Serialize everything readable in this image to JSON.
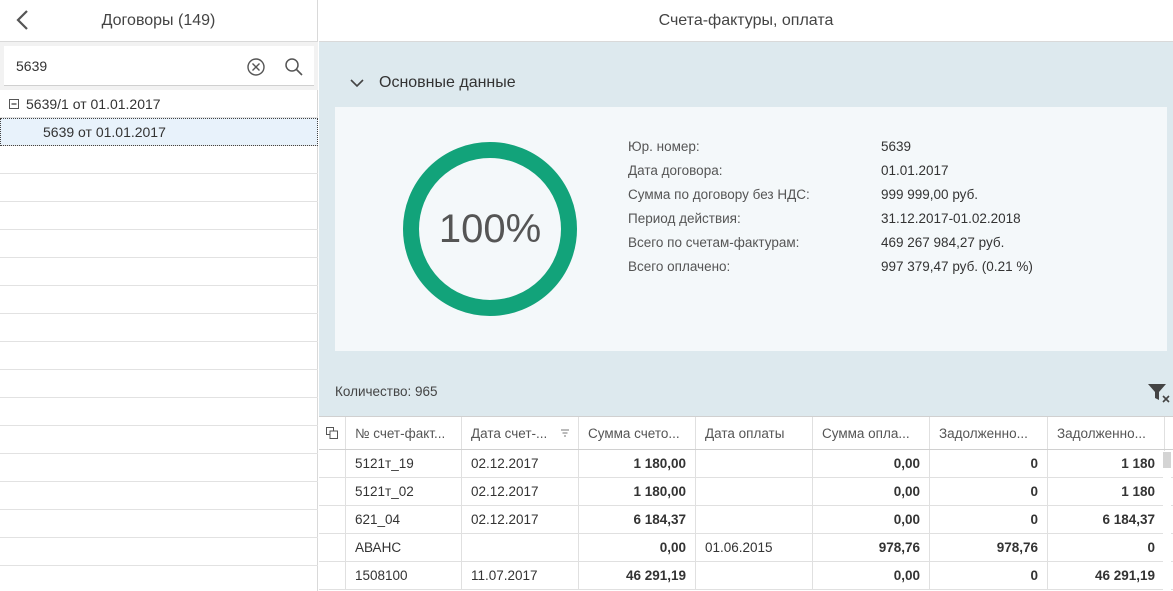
{
  "left": {
    "title": "Договоры (149)",
    "search_value": "5639",
    "tree": [
      {
        "label": "5639/1 от 01.01.2017"
      },
      {
        "label": "5639 от 01.01.2017"
      }
    ]
  },
  "right": {
    "title": "Счета-фактуры, оплата",
    "section_title": "Основные данные",
    "progress_percent": 100,
    "progress_text": "100%",
    "info": [
      {
        "label": "Юр. номер:",
        "value": "5639"
      },
      {
        "label": "Дата договора:",
        "value": "01.01.2017"
      },
      {
        "label": "Сумма по договору без НДС:",
        "value": "999 999,00 руб."
      },
      {
        "label": "Период действия:",
        "value": "31.12.2017-01.02.2018"
      },
      {
        "label": "Всего по счетам-фактурам:",
        "value": "469 267 984,27 руб."
      },
      {
        "label": "Всего оплачено:",
        "value": "997 379,47 руб. (0.21 %)"
      }
    ],
    "count_label": "Количество: 965"
  },
  "grid": {
    "columns": [
      "№ счет-факт...",
      "Дата счет-...",
      "Сумма счето...",
      "Дата оплаты",
      "Сумма опла...",
      "Задолженно...",
      "Задолженно..."
    ],
    "rows": [
      [
        "5121т_19",
        "02.12.2017",
        "1 180,00",
        "",
        "0,00",
        "0",
        "1 180"
      ],
      [
        "5121т_02",
        "02.12.2017",
        "1 180,00",
        "",
        "0,00",
        "0",
        "1 180"
      ],
      [
        "621_04",
        "02.12.2017",
        "6 184,37",
        "",
        "0,00",
        "0",
        "6 184,37"
      ],
      [
        "АВАНС",
        "",
        "0,00",
        "01.06.2015",
        "978,76",
        "978,76",
        "0"
      ],
      [
        "1508100",
        "11.07.2017",
        "46 291,19",
        "",
        "0,00",
        "0",
        "46 291,19"
      ]
    ]
  },
  "colors": {
    "accent_green": "#12a37a",
    "panel_bg": "#dde9ee",
    "card_bg": "#f4f8fa",
    "selected_row": "#e8f2fb"
  },
  "icons": [
    "back-arrow-icon",
    "clear-icon",
    "search-icon",
    "collapse-minus-icon",
    "chevron-down-icon",
    "filter-clear-icon",
    "column-chooser-icon",
    "sort-icon"
  ]
}
